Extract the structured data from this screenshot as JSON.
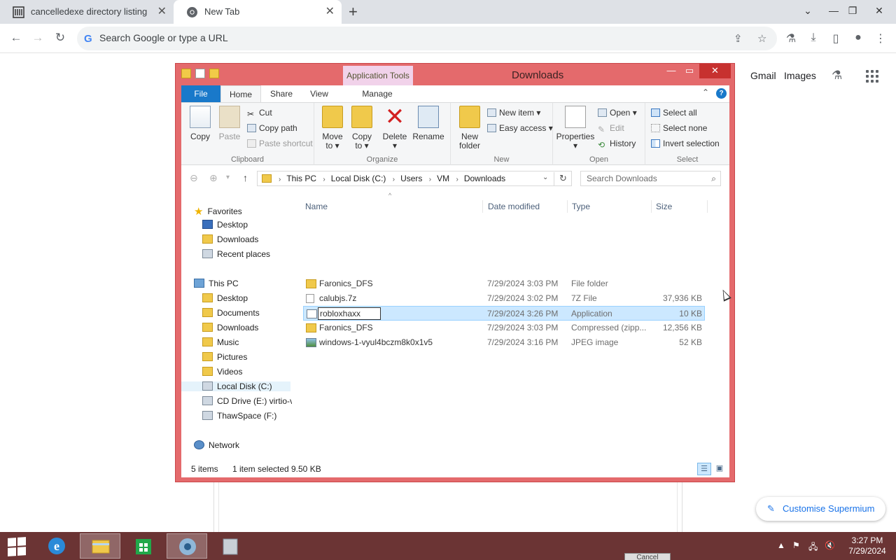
{
  "browser": {
    "tabs": [
      {
        "title": "cancelledexe directory listing"
      },
      {
        "title": "New Tab"
      }
    ],
    "new_tab_symbol": "+",
    "omnibox_placeholder": "Search Google or type a URL"
  },
  "page": {
    "links": {
      "gmail": "Gmail",
      "images": "Images"
    },
    "customise_label": "Customise Supermium"
  },
  "explorer": {
    "title": "Downloads",
    "app_tools_label": "Application Tools",
    "ribbon_tabs": {
      "file": "File",
      "home": "Home",
      "share": "Share",
      "view": "View",
      "manage": "Manage"
    },
    "clipboard": {
      "copy": "Copy",
      "paste": "Paste",
      "cut": "Cut",
      "copy_path": "Copy path",
      "paste_shortcut": "Paste shortcut",
      "label": "Clipboard"
    },
    "organize": {
      "move_to_1": "Move",
      "move_to_2": "to",
      "copy_to_1": "Copy",
      "copy_to_2": "to",
      "delete": "Delete",
      "rename": "Rename",
      "label": "Organize"
    },
    "new": {
      "new_folder_1": "New",
      "new_folder_2": "folder",
      "new_item": "New item",
      "easy_access": "Easy access",
      "label": "New"
    },
    "open": {
      "properties": "Properties",
      "open": "Open",
      "edit": "Edit",
      "history": "History",
      "label": "Open"
    },
    "select": {
      "select_all": "Select all",
      "select_none": "Select none",
      "invert": "Invert selection",
      "label": "Select"
    },
    "breadcrumb": [
      "This PC",
      "Local Disk (C:)",
      "Users",
      "VM",
      "Downloads"
    ],
    "search_placeholder": "Search Downloads",
    "nav": {
      "favorites": "Favorites",
      "fav_items": [
        "Desktop",
        "Downloads",
        "Recent places"
      ],
      "this_pc": "This PC",
      "pc_items": [
        "Desktop",
        "Documents",
        "Downloads",
        "Music",
        "Pictures",
        "Videos",
        "Local Disk (C:)",
        "CD Drive (E:) virtio-v",
        "ThawSpace (F:)"
      ],
      "network": "Network"
    },
    "columns": {
      "name": "Name",
      "date": "Date modified",
      "type": "Type",
      "size": "Size"
    },
    "files": [
      {
        "name": "Faronics_DFS",
        "date": "7/29/2024 3:03 PM",
        "type": "File folder",
        "size": "",
        "icon": "folder-icon"
      },
      {
        "name": "calubjs.7z",
        "date": "7/29/2024 3:02 PM",
        "type": "7Z File",
        "size": "37,936 KB",
        "icon": "file-icon"
      },
      {
        "name": "robloxhaxx",
        "date": "7/29/2024 3:26 PM",
        "type": "Application",
        "size": "10 KB",
        "icon": "application-icon",
        "selected": true
      },
      {
        "name": "Faronics_DFS",
        "date": "7/29/2024 3:03 PM",
        "type": "Compressed (zipp...",
        "size": "12,356 KB",
        "icon": "zip-folder-icon"
      },
      {
        "name": "windows-1-vyul4bczm8k0x1v5",
        "date": "7/29/2024 3:16 PM",
        "type": "JPEG image",
        "size": "52 KB",
        "icon": "image-icon"
      }
    ],
    "status": {
      "count": "5 items",
      "selected": "1 item selected",
      "size": "9.50 KB"
    }
  },
  "taskbar": {
    "time": "3:27 PM",
    "date": "7/29/2024",
    "peek_button": "Cancel"
  }
}
